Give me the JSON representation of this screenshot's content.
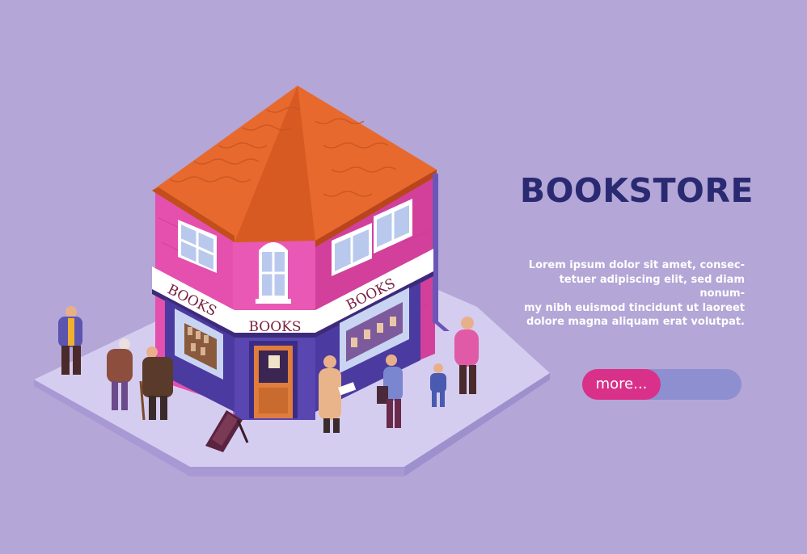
{
  "banner": {
    "title": "BOOKSTORE",
    "description_lines": [
      "Lorem ipsum dolor sit amet, consec-",
      "tetuer adipiscing elit, sed diam nonum-",
      "my nibh euismod tincidunt ut laoreet",
      "dolore magna aliquam erat volutpat."
    ],
    "more_label": "more...",
    "colors": {
      "background": "#b4a6d6",
      "title": "#2a2a72",
      "accent": "#d9318a",
      "track": "#8d8fd0"
    }
  },
  "store": {
    "sign_left": "BOOKS",
    "sign_front": "BOOKS",
    "sign_right": "BOOKS"
  }
}
